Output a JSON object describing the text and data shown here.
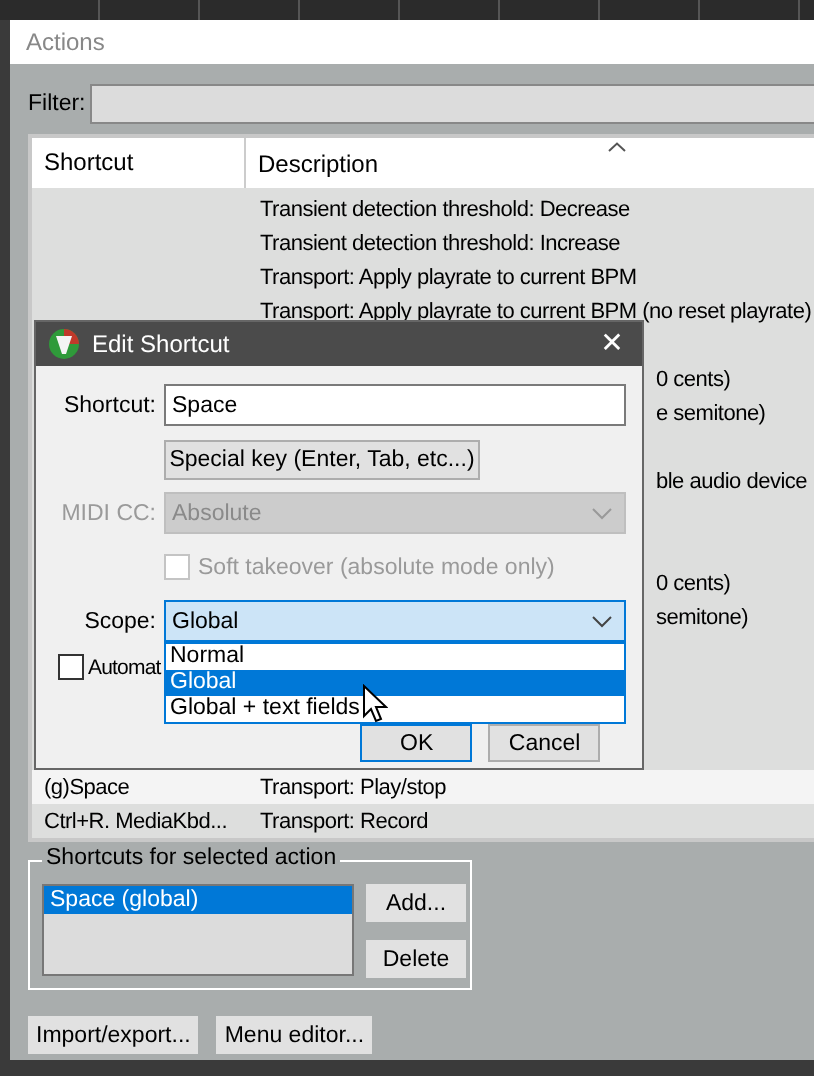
{
  "window": {
    "title": "Actions"
  },
  "filter": {
    "label": "Filter:"
  },
  "table": {
    "columns": [
      "Shortcut",
      "Description"
    ],
    "rows": [
      {
        "kind": "full",
        "description": "Transient detection threshold: Decrease",
        "selected": false
      },
      {
        "kind": "full",
        "description": "Transient detection threshold: Increase",
        "selected": false
      },
      {
        "kind": "full",
        "description": "Transport: Apply playrate to current BPM",
        "selected": false
      },
      {
        "kind": "full",
        "description": "Transport: Apply playrate to current BPM (no reset playrate)",
        "selected": false
      },
      {
        "kind": "gap"
      },
      {
        "kind": "partial",
        "description": "0 cents)",
        "selected": false
      },
      {
        "kind": "partial",
        "description": "e semitone)",
        "selected": false
      },
      {
        "kind": "gap"
      },
      {
        "kind": "partial",
        "description": "ble audio device",
        "selected": false
      },
      {
        "kind": "gap"
      },
      {
        "kind": "gap"
      },
      {
        "kind": "partial",
        "description": "0 cents)",
        "selected": false
      },
      {
        "kind": "partial",
        "description": "semitone)",
        "selected": false
      },
      {
        "kind": "gap"
      },
      {
        "kind": "gap"
      },
      {
        "kind": "gap"
      },
      {
        "kind": "gap"
      },
      {
        "kind": "full",
        "shortcut": "(g)Space",
        "description": "Transport: Play/stop",
        "selected": true
      },
      {
        "kind": "full",
        "shortcut": "Ctrl+R. MediaKbd...",
        "description": "Transport: Record",
        "selected": false
      }
    ]
  },
  "shortcuts_group": {
    "title": "Shortcuts for selected action",
    "items": [
      {
        "label": "Space (global)",
        "selected": true
      }
    ],
    "buttons": [
      "Add...",
      "Delete"
    ]
  },
  "bottom_buttons": [
    "Import/export...",
    "Menu editor..."
  ],
  "dialog": {
    "title": "Edit Shortcut",
    "close": "✕",
    "shortcut_label": "Shortcut:",
    "shortcut_value": "Space",
    "special_key_button": "Special key (Enter, Tab, etc...)",
    "midi_label": "MIDI CC:",
    "midi_value": "Absolute",
    "midi_disabled": true,
    "soft_takeover": {
      "label": "Soft takeover (absolute mode only)",
      "checked": false,
      "disabled": true
    },
    "scope_label": "Scope:",
    "scope_value": "Global",
    "scope_options": [
      {
        "label": "Normal",
        "selected": false
      },
      {
        "label": "Global",
        "selected": true
      },
      {
        "label": "Global + text fields",
        "selected": false
      }
    ],
    "automation": {
      "label": "Automat",
      "checked": false
    },
    "buttons": [
      "OK",
      "Cancel"
    ]
  }
}
